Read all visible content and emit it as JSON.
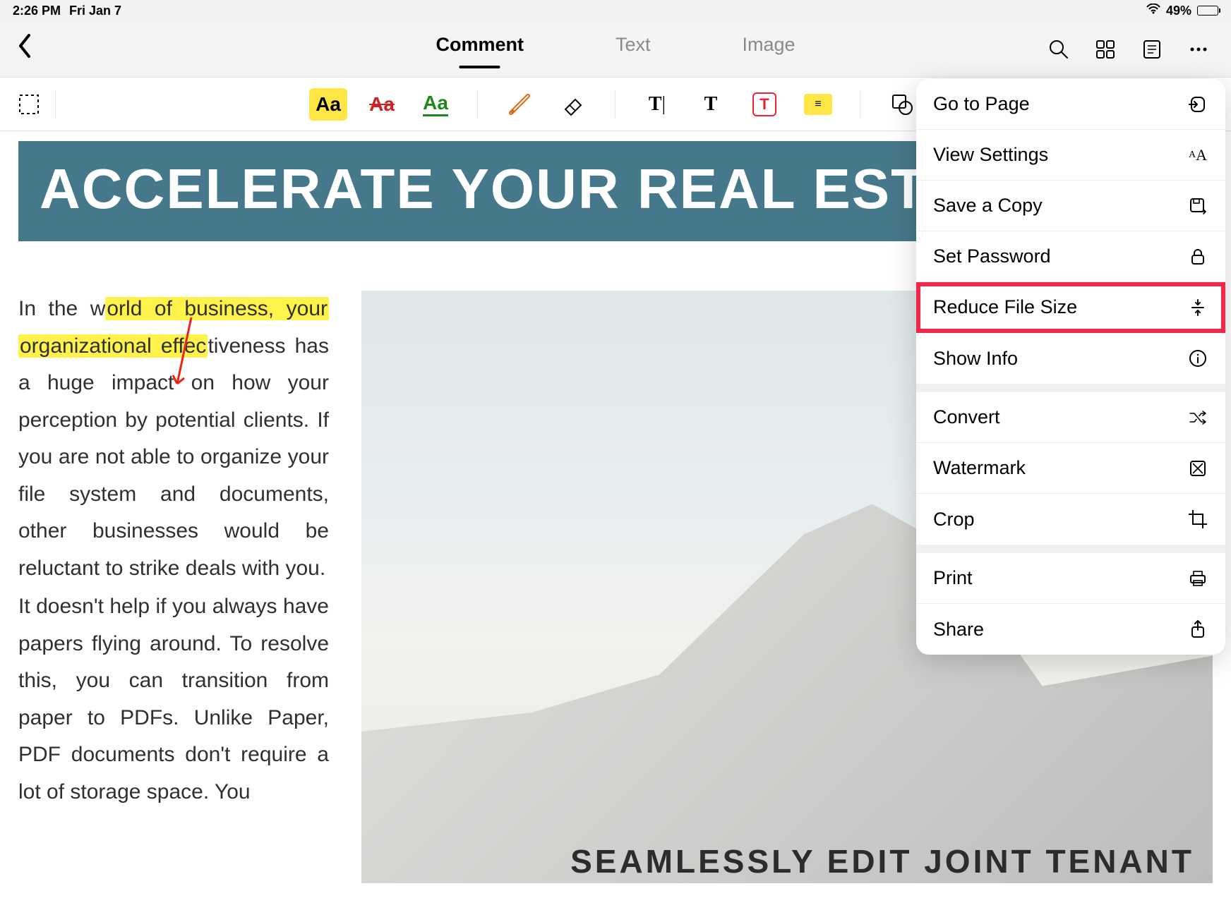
{
  "status": {
    "time": "2:26 PM",
    "date": "Fri Jan 7",
    "battery_pct": "49%"
  },
  "tabs": {
    "comment": "Comment",
    "text": "Text",
    "image": "Image"
  },
  "doc": {
    "banner": "ACCELERATE YOUR REAL ESTA",
    "p1": "In the world of business, your organizational effectiveness has a huge impact on how your perception by potential clients. If you are not able to organize your file system and documents, other businesses would be reluctant to strike deals with you.",
    "p2": "It doesn't help if you always have papers flying around. To resolve this, you can transition from paper to PDFs. Unlike Paper, PDF documents don't require a lot of storage space. You",
    "highlight_frag1": "orld of business, your",
    "highlight_frag2": "organizational effec",
    "footer": "SEAMLESSLY  EDIT  JOINT  TENANT"
  },
  "menu": {
    "go_to_page": "Go to Page",
    "view_settings": "View Settings",
    "save_copy": "Save a Copy",
    "set_password": "Set Password",
    "reduce_file_size": "Reduce File Size",
    "show_info": "Show Info",
    "convert": "Convert",
    "watermark": "Watermark",
    "crop": "Crop",
    "print": "Print",
    "share": "Share"
  }
}
